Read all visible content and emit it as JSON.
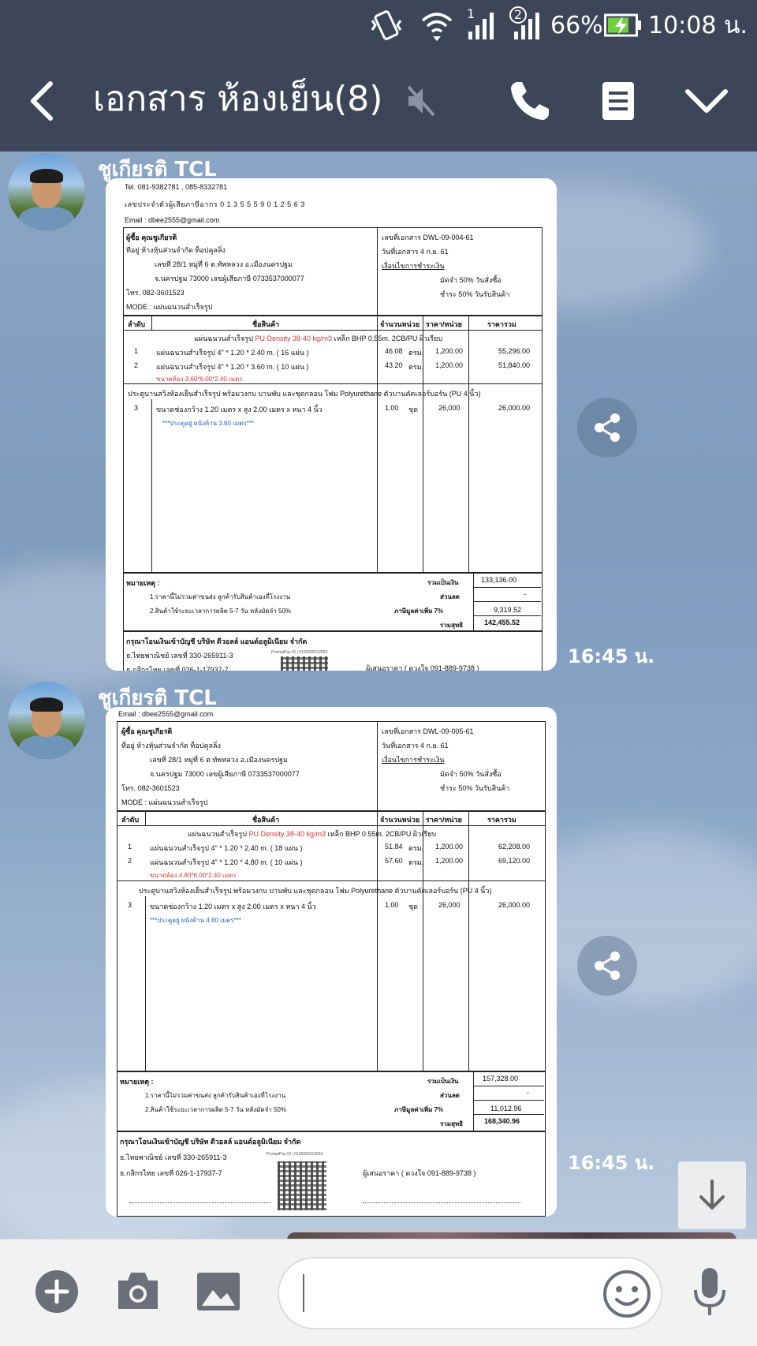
{
  "status_bar": {
    "battery": "66%",
    "time": "10:08 น.",
    "sim1_label": "1",
    "sim2_label": "2",
    "icons": [
      "vibrate-icon",
      "wifi-icon",
      "signal-icon",
      "signal-icon",
      "battery-charging-icon"
    ]
  },
  "header": {
    "title": "เอกสาร ห้องเย็น(8)",
    "icons": [
      "back-icon",
      "mute-icon",
      "phone-icon",
      "notes-icon",
      "chevron-down-icon"
    ]
  },
  "colors": {
    "header_bg": "#3c4658",
    "chat_bg": "#7e99bb",
    "input_bg": "#f2f2f2",
    "price_red": "#d43a3a",
    "note_blue": "#2b62c6"
  },
  "messages": [
    {
      "sender": "ชูเกียรติ TCL",
      "time": "16:45 น.",
      "document": {
        "tel": "Tel. 081-9382781 , 085-8332781",
        "tax_line": "เลขประจำตัวผู้เสียภาษีอากร 0 1 3 5 5 5 9 0 1 2 5 6 3",
        "email": "Email : dbee2555@gmail.com",
        "buyer": "ผู้ซื้อ   คุณชูเกียรติ",
        "address_label": "ที่อยู่   ห้างหุ้นส่วนจำกัด ท็อปคูลลิ่ง",
        "address_1": "เลขที่ 28/1 หมู่ที่ 6 ต.ทัพหลวง อ.เมืองนครปฐม",
        "address_2": "จ.นครปฐม   73000     เลขผู้เสียภาษี 0733537000077",
        "phone": "โทร.  082-3601523",
        "mode": "MODE : แผ่นฉนวนสำเร็จรูป",
        "doc_no": "เลขที่เอกสาร     DWL-09-004-61",
        "doc_date": "วันที่เอกสาร                 4 ก.ย. 61",
        "payment_title": "เงื่อนไขการชำระเงิน",
        "payment_1": "มัดจำ 50% วันสั่งซื้อ",
        "payment_2": "ชำระ 50% วันรับสินค้า",
        "col_no": "ลำดับ",
        "col_item": "ชื่อสินค้า",
        "col_qty": "จำนวนหน่วย",
        "col_price": "ราคา/หน่วย",
        "col_total": "ราคารวม",
        "group_title_a": "แผ่นฉนวนสำเร็จรูป ",
        "group_title_red": "PU Density 38-40 kg/m3",
        "group_title_b": " เหล็ก BHP 0.55m. 2CB/PU ผิวเรียบ",
        "rows": [
          {
            "no": "1",
            "item": "แผ่นฉนวนสำเร็จรูป     4\"   *   1.20   *   2.40   m.  (  16  แผ่น )",
            "qty": "46.08",
            "unit": "ตรม.",
            "price": "1,200.00",
            "total": "55,296.00"
          },
          {
            "no": "2",
            "item": "แผ่นฉนวนสำเร็จรูป     4\"   *   1.20   *   3.60   m.  (  10  แผ่น )",
            "qty": "43.20",
            "unit": "ตรม.",
            "price": "1,200.00",
            "total": "51,840.00"
          }
        ],
        "size_note": "ขนาดห้อง 3.60*6.00*2.40 เมตร",
        "door_group": "ประตูบานสวิงห้องเย็นสำเร็จรูป พร้อมวงกบ บานพับ และชุดกลอน โฟม Polyurethane ตัวบานคัดเลอร์บอร์น (PU 4 นิ้ว)",
        "door_row": {
          "no": "3",
          "item": "ขนาดช่องกว้าง 1.20 เมตร x สูง 2.00 เมตร x หนา 4 นิ้ว",
          "qty": "1.00",
          "unit": "ชุด",
          "price": "26,000",
          "total": "26,000.00"
        },
        "door_note": "***ประตูอยู่ ผนังด้าน 3.60 เมตร***",
        "remark_label": "หมายเหตุ :",
        "remark_1": "1.ราคานี้ไม่รวมค่าขนส่ง ลูกค้ารับสินค้าเองที่โรงงาน",
        "remark_2": "2.สินค้าใช้ระยะเวลาการผลิต 5-7 วัน หลังมัดจำ 50%",
        "sum_label": "รวมเป็นเงิน",
        "sum_value": "133,136.00",
        "discount_label": "ส่วนลด",
        "discount_value": "-",
        "vat_label": "ภาษีมูลค่าเพิ่ม 7%",
        "vat_value": "9,319.52",
        "net_label": "รวมสุทธิ",
        "net_value": "142,455.52",
        "bank_title": "กรุณาโอนเงินเข้าบัญชี บริษัท ดีวอลล์ แอนด์อลูมิเนียม จำกัด",
        "bank_1": "ธ.ไทยพาณิชย์ เลขที่ 330-265911-3",
        "bank_2": "ธ.กสิกรไทย เลขที่ 026-1-17937-7",
        "promptpay": "PromptPay ID | 0135555012563",
        "signer": "ผู้เสนอราคา ( ดวงใจ 091-889-9738 )"
      }
    },
    {
      "sender": "ชูเกียรติ TCL",
      "time": "16:45 น.",
      "document": {
        "email": "Email : dbee2555@gmail.com",
        "buyer": "ผู้ซื้อ   คุณชูเกียรติ",
        "address_label": "ที่อยู่   ห้างหุ้นส่วนจำกัด ท็อปคูลลิ่ง",
        "address_1": "เลขที่ 28/1 หมู่ที่ 6 ต.ทัพหลวง อ.เมืองนครปฐม",
        "address_2": "จ.นครปฐม   73000     เลขผู้เสียภาษี 0733537000077",
        "phone": "โทร.  082-3601523",
        "mode": "MODE : แผ่นฉนวนสำเร็จรูป",
        "doc_no": "เลขที่เอกสาร     DWL-09-005-61",
        "doc_date": "วันที่เอกสาร                 4 ก.ย. 61",
        "payment_title": "เงื่อนไขการชำระเงิน",
        "payment_1": "มัดจำ 50% วันสั่งซื้อ",
        "payment_2": "ชำระ 50% วันรับสินค้า",
        "col_no": "ลำดับ",
        "col_item": "ชื่อสินค้า",
        "col_qty": "จำนวนหน่วย",
        "col_price": "ราคา/หน่วย",
        "col_total": "ราคารวม",
        "group_title_a": "แผ่นฉนวนสำเร็จรูป ",
        "group_title_red": "PU Density 38-40 kg/m3",
        "group_title_b": " เหล็ก BHP 0.55m. 2CB/PU ผิวเรียบ",
        "rows": [
          {
            "no": "1",
            "item": "แผ่นฉนวนสำเร็จรูป     4\"   *   1.20   *   2.40   m.  (  18  แผ่น )",
            "qty": "51.84",
            "unit": "ตรม.",
            "price": "1,200.00",
            "total": "62,208.00"
          },
          {
            "no": "2",
            "item": "แผ่นฉนวนสำเร็จรูป     4\"   *   1.20   *   4.80   m.  (  10  แผ่น )",
            "qty": "57.60",
            "unit": "ตรม.",
            "price": "1,200.00",
            "total": "69,120.00"
          }
        ],
        "size_note": "ขนาดห้อง 4.80*6.00*2.40 เมตร",
        "door_group": "ประตูบานสวิงห้องเย็นสำเร็จรูป พร้อมวงกบ บานพับ และชุดกลอน โฟม Polyurethane ตัวบานคัดเลอร์บอร์น (PU 4 นิ้ว)",
        "door_row": {
          "no": "3",
          "item": "ขนาดช่องกว้าง 1.20 เมตร x สูง 2.00 เมตร x หนา 4 นิ้ว",
          "qty": "1.00",
          "unit": "ชุด",
          "price": "26,000",
          "total": "26,000.00"
        },
        "door_note": "***ประตูอยู่ ผนังด้าน 4.80 เมตร***",
        "remark_label": "หมายเหตุ :",
        "remark_1": "1.ราคานี้ไม่รวมค่าขนส่ง ลูกค้ารับสินค้าเองที่โรงงาน",
        "remark_2": "2.สินค้าใช้ระยะเวลาการผลิต 5-7 วัน หลังมัดจำ 50%",
        "sum_label": "รวมเป็นเงิน",
        "sum_value": "157,328.00",
        "discount_label": "ส่วนลด",
        "discount_value": "-",
        "vat_label": "ภาษีมูลค่าเพิ่ม 7%",
        "vat_value": "11,012.96",
        "net_label": "รวมสุทธิ",
        "net_value": "168,340.96",
        "bank_title": "กรุณาโอนเงินเข้าบัญชี บริษัท ดีวอลล์ แอนด์อลูมิเนียม จำกัด",
        "bank_1": "ธ.ไทยพาณิชย์ เลขที่ 330-265911-3",
        "bank_2": "ธ.กสิกรไทย เลขที่ 026-1-17937-7",
        "promptpay": "PromptPay ID | 0135555012563",
        "signer": "ผู้เสนอราคา ( ดวงใจ 091-889-9738 )"
      }
    }
  ],
  "input_bar": {
    "placeholder": "",
    "icons": [
      "plus-icon",
      "camera-icon",
      "image-icon",
      "emoji-icon",
      "microphone-icon"
    ]
  },
  "scroll_button_icon": "arrow-down-icon"
}
